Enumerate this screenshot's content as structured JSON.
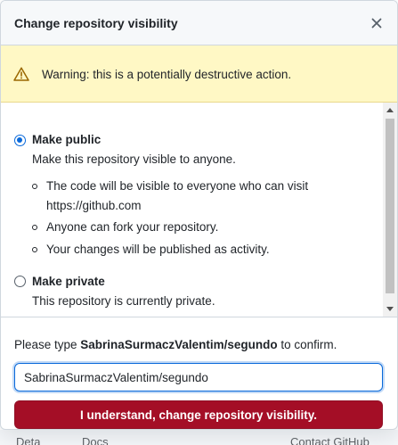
{
  "dialog": {
    "title": "Change repository visibility",
    "close_label": "×"
  },
  "warning": {
    "text": "Warning: this is a potentially destructive action."
  },
  "options": {
    "public": {
      "label": "Make public",
      "description": "Make this repository visible to anyone.",
      "selected": true,
      "bullets": [
        "The code will be visible to everyone who can visit",
        "https://github.com",
        "Anyone can fork your repository.",
        "Your changes will be published as activity."
      ]
    },
    "private": {
      "label": "Make private",
      "description": "This repository is currently private.",
      "selected": false
    }
  },
  "confirm": {
    "prefix": "Please type ",
    "repo": "SabrinaSurmaczValentim/segundo",
    "suffix": " to confirm.",
    "input_value": "SabrinaSurmaczValentim/segundo"
  },
  "button": {
    "label": "I understand, change repository visibility."
  },
  "background": {
    "left_fragment": "Deta",
    "mid_fragment": "Docs",
    "right_fragment": "Contact GitHub"
  },
  "colors": {
    "accent": "#0969da",
    "danger": "#a40e26",
    "warning_bg": "#fff8c5"
  }
}
